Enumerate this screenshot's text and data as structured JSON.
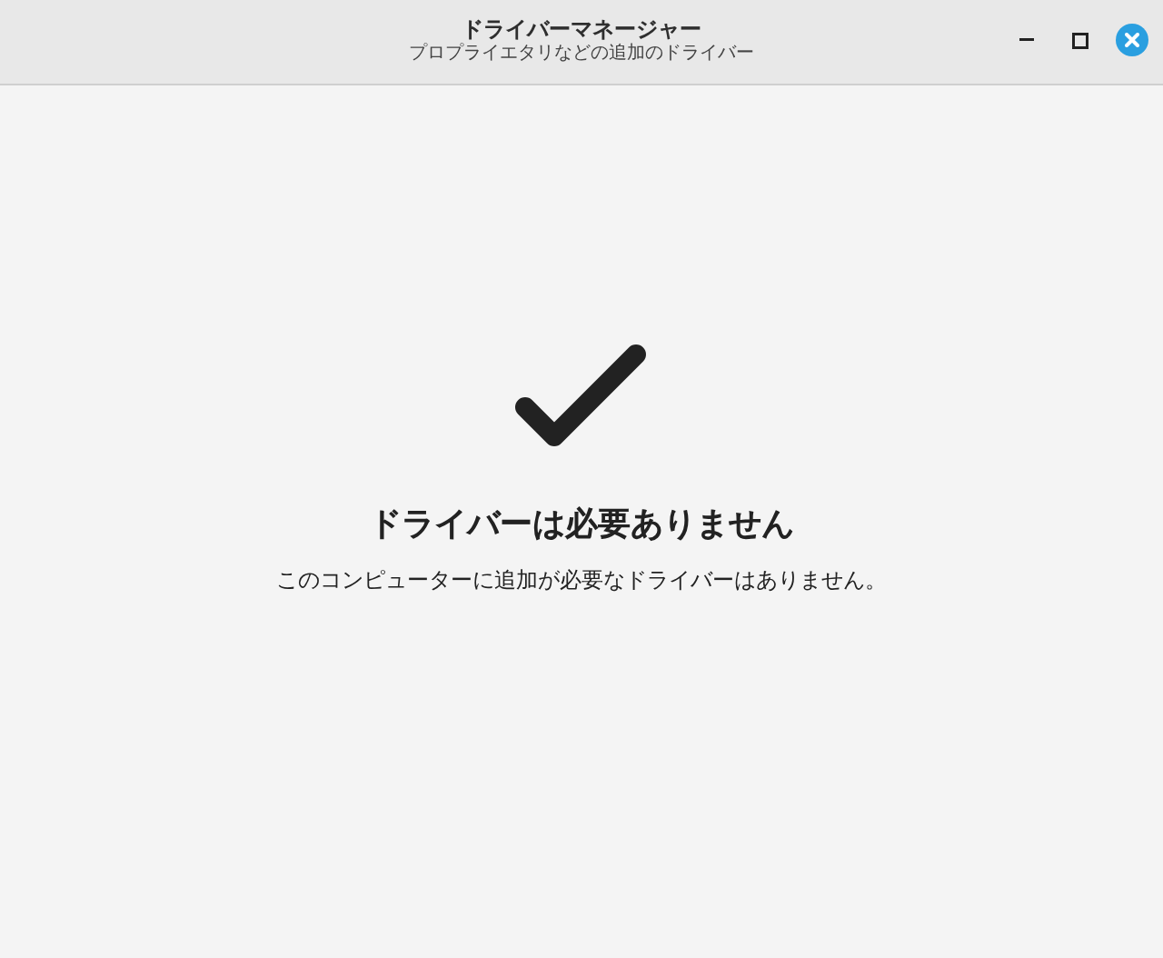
{
  "window": {
    "title": "ドライバーマネージャー",
    "subtitle": "プロプライエタリなどの追加のドライバー"
  },
  "status": {
    "heading": "ドライバーは必要ありません",
    "message": "このコンピューターに追加が必要なドライバーはありません。"
  }
}
